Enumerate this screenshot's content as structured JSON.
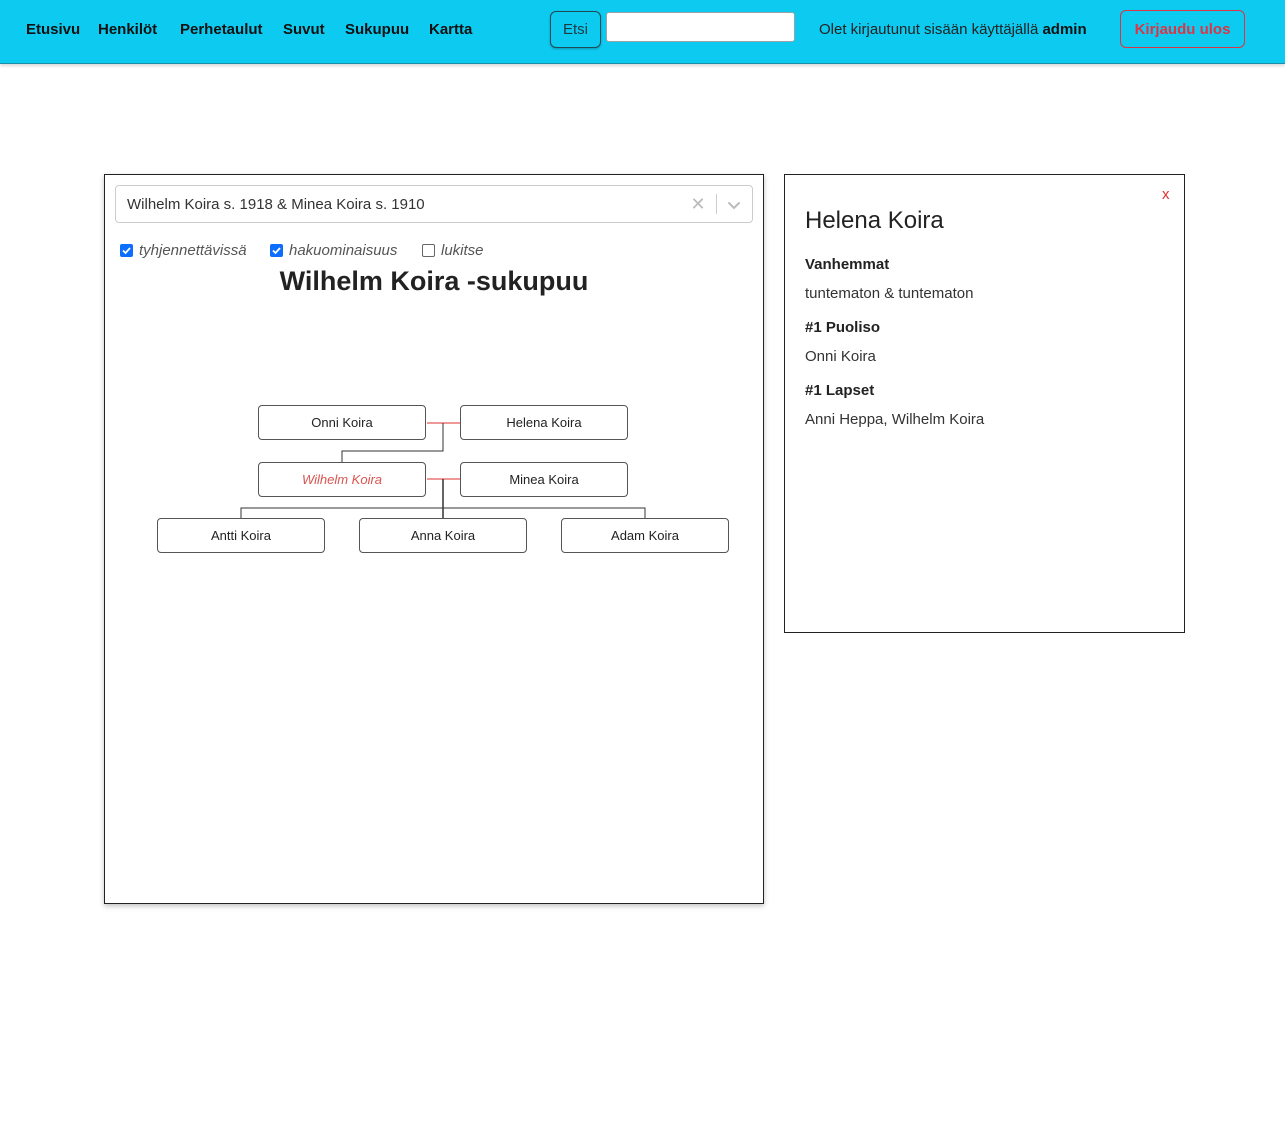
{
  "nav": {
    "links": [
      "Etusivu",
      "Henkilöt",
      "Perhetaulut",
      "Suvut",
      "Sukupuu",
      "Kartta"
    ],
    "search_button": "Etsi",
    "search_value": "",
    "login_prefix": "Olet kirjautunut sisään käyttäjällä",
    "login_user": "admin",
    "logout_button": "Kirjaudu ulos"
  },
  "tree_panel": {
    "selected_family": "Wilhelm Koira s. 1918 & Minea Koira s. 1910",
    "options": [
      {
        "label": "tyhjennettävissä",
        "checked": true
      },
      {
        "label": "hakuominaisuus",
        "checked": true
      },
      {
        "label": "lukitse",
        "checked": false
      }
    ],
    "title": "Wilhelm Koira -sukupuu",
    "people": {
      "onni": "Onni Koira",
      "helena": "Helena Koira",
      "wilhelm": "Wilhelm Koira",
      "minea": "Minea Koira",
      "antti": "Antti Koira",
      "anna": "Anna Koira",
      "adam": "Adam Koira"
    },
    "colors": {
      "spouse_line": "#e0302f",
      "focus_text": "#d9534f"
    }
  },
  "info_panel": {
    "close": "x",
    "name": "Helena Koira",
    "parents_heading": "Vanhemmat",
    "parents_value": "tuntematon & tuntematon",
    "spouse_heading": "#1 Puoliso",
    "spouse_value": "Onni Koira",
    "children_heading": "#1 Lapset",
    "children_value": "Anni Heppa, Wilhelm Koira"
  }
}
